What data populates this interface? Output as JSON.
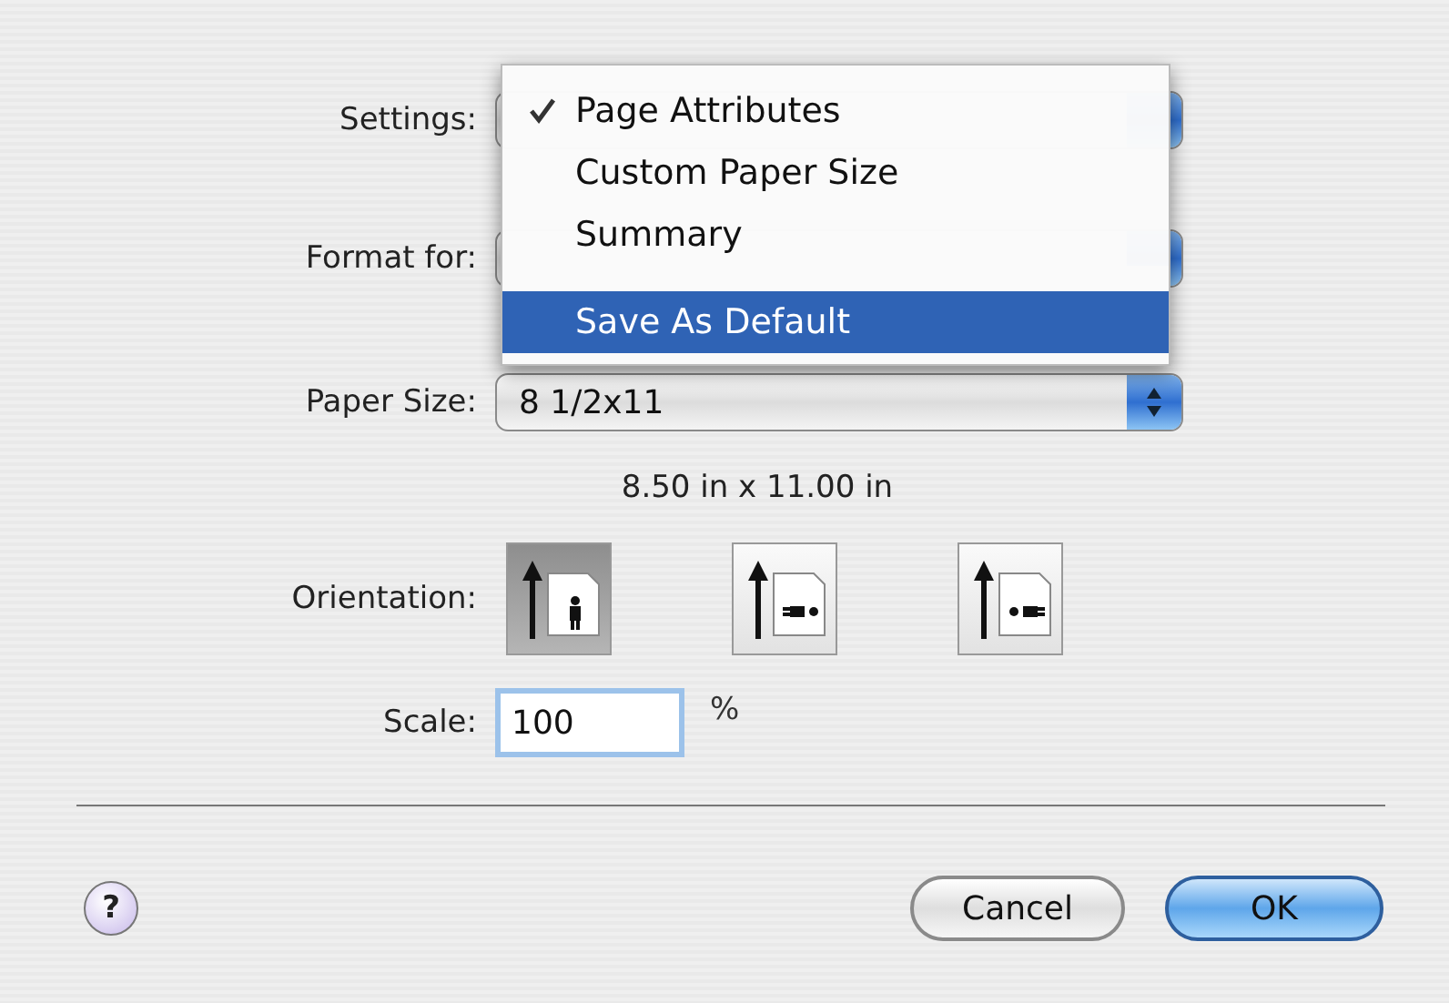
{
  "settings": {
    "label": "Settings:"
  },
  "settings_menu": {
    "items": [
      {
        "label": "Page Attributes",
        "checked": true,
        "selected": false,
        "separator_before": false
      },
      {
        "label": "Custom Paper Size",
        "checked": false,
        "selected": false,
        "separator_before": false
      },
      {
        "label": "Summary",
        "checked": false,
        "selected": false,
        "separator_before": false
      },
      {
        "label": "Save As Default",
        "checked": false,
        "selected": true,
        "separator_before": true
      }
    ]
  },
  "format_for": {
    "label": "Format for:"
  },
  "paper_size": {
    "label": "Paper Size:",
    "value": "8 1/2x11",
    "dimensions": "8.50 in x 11.00 in"
  },
  "orientation": {
    "label": "Orientation:",
    "options": [
      {
        "kind": "portrait",
        "selected": true
      },
      {
        "kind": "landscape_left",
        "selected": false
      },
      {
        "kind": "landscape_right",
        "selected": false
      }
    ]
  },
  "scale": {
    "label": "Scale:",
    "value": "100",
    "unit": "%"
  },
  "help": {
    "label": "?"
  },
  "buttons": [
    {
      "label": "Cancel",
      "kind": "secondary"
    },
    {
      "label": "OK",
      "kind": "default"
    }
  ]
}
